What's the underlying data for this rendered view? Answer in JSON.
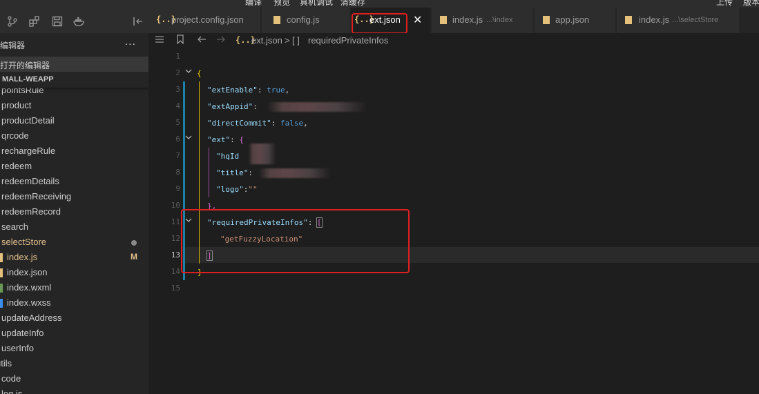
{
  "top_menu": [
    "编译",
    "预览",
    "真机调试",
    "清缓存",
    "上传",
    "版本"
  ],
  "sidebar": {
    "toolbar_icons": [
      "source-control-icon",
      "extensions-icon",
      "save-icon",
      "docker-icon",
      "collapse-icon"
    ],
    "explorer_title": "编辑器",
    "more": "...",
    "open_editors": "打开的编辑器",
    "project": "MALL-WEAPP",
    "tree": [
      {
        "label": "pointsRule",
        "kind": "folder"
      },
      {
        "label": "product",
        "kind": "folder"
      },
      {
        "label": "productDetail",
        "kind": "folder"
      },
      {
        "label": "qrcode",
        "kind": "folder"
      },
      {
        "label": "rechargeRule",
        "kind": "folder"
      },
      {
        "label": "redeem",
        "kind": "folder"
      },
      {
        "label": "redeemDetails",
        "kind": "folder"
      },
      {
        "label": "redeemReceiving",
        "kind": "folder"
      },
      {
        "label": "redeemRecord",
        "kind": "folder"
      },
      {
        "label": "search",
        "kind": "folder"
      },
      {
        "label": "selectStore",
        "kind": "folder",
        "status": "dot"
      },
      {
        "label": "index.js",
        "kind": "file",
        "status": "M",
        "color": "#e5c07b"
      },
      {
        "label": "index.json",
        "kind": "file",
        "color": "#e5c07b"
      },
      {
        "label": "index.wxml",
        "kind": "file",
        "color": "#6a9955"
      },
      {
        "label": "index.wxss",
        "kind": "file",
        "color": "#3b8eea"
      },
      {
        "label": "updateAddress",
        "kind": "folder"
      },
      {
        "label": "updateInfo",
        "kind": "folder"
      },
      {
        "label": "userInfo",
        "kind": "folder"
      },
      {
        "label": "utils",
        "kind": "folder"
      },
      {
        "label": "code",
        "kind": "folder"
      },
      {
        "label": "log.js",
        "kind": "folder"
      }
    ]
  },
  "tabs": [
    {
      "icon": "{..}",
      "name": "project.config.json",
      "desc": ""
    },
    {
      "icon": "js",
      "name": "config.js",
      "desc": ""
    },
    {
      "icon": "{..}",
      "name": "ext.json",
      "desc": "",
      "active": true,
      "close": "✕"
    },
    {
      "icon": "js",
      "name": "index.js",
      "desc": "...\\index"
    },
    {
      "icon": "{..}",
      "name": "app.json",
      "desc": ""
    },
    {
      "icon": "js",
      "name": "index.js",
      "desc": "...\\selectStore"
    }
  ],
  "breadcrumb": {
    "file_icon": "{..}",
    "file": "ext.json",
    "sep": ">",
    "node_icon": "[ ]",
    "node": "requiredPrivateInfos"
  },
  "editor": {
    "line_numbers": [
      "1",
      "2",
      "3",
      "4",
      "5",
      "6",
      "7",
      "8",
      "9",
      "10",
      "11",
      "12",
      "13",
      "14",
      "15"
    ],
    "current_line": "13",
    "code": {
      "l2_open": "{",
      "l3_key": "\"extEnable\"",
      "l3_colon": ": ",
      "l3_val": "true",
      "l3_comma": ",",
      "l4_key": "\"extAppid\"",
      "l4_colon": ":",
      "l5_key": "\"directCommit\"",
      "l5_colon": ": ",
      "l5_val": "false",
      "l5_comma": ",",
      "l6_key": "\"ext\"",
      "l6_colon": ": ",
      "l6_open": "{",
      "l7_key": "\"hqId",
      "l8_key": "\"title\"",
      "l8_colon": ":",
      "l9_key": "\"logo\"",
      "l9_colon": ":",
      "l9_val": "\"\"",
      "l10_close": "},",
      "l11_key": "\"requiredPrivateInfos\"",
      "l11_colon": ": ",
      "l11_open": "[",
      "l12_val": "\"getFuzzyLocation\"",
      "l13_close": "]",
      "l14_close": "}"
    }
  },
  "colors": {
    "highlight_box": "#e02020",
    "modified": "#e2c08d"
  }
}
